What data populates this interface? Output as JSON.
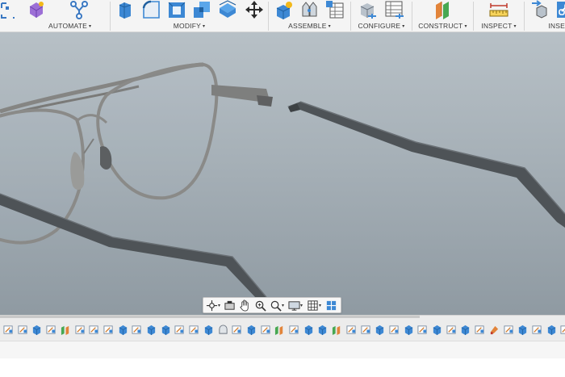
{
  "toolbar": {
    "groups": [
      {
        "id": "automate",
        "label": "AUTOMATE",
        "caret": "▾"
      },
      {
        "id": "modify",
        "label": "MODIFY",
        "caret": "▾"
      },
      {
        "id": "assemble",
        "label": "ASSEMBLE",
        "caret": "▾"
      },
      {
        "id": "configure",
        "label": "CONFIGURE",
        "caret": "▾"
      },
      {
        "id": "construct",
        "label": "CONSTRUCT",
        "caret": "▾"
      },
      {
        "id": "inspect",
        "label": "INSPECT",
        "caret": "▾"
      },
      {
        "id": "insert",
        "label": "INSE",
        "caret": ""
      }
    ],
    "icons": {
      "automate": [
        "select-bracket-icon",
        "create-form-icon",
        "automate-graph-icon"
      ],
      "modify": [
        "press-pull-icon",
        "fillet-icon",
        "shell-icon",
        "combine-icon",
        "offset-face-icon",
        "move-icon"
      ],
      "assemble": [
        "new-component-icon",
        "joint-icon",
        "component-table-icon"
      ],
      "configure": [
        "configure-icon",
        "configuration-table-icon"
      ],
      "construct": [
        "offset-plane-icon"
      ],
      "inspect": [
        "measure-icon"
      ],
      "insert": [
        "insert-derive-icon",
        "insert-link-icon"
      ]
    }
  },
  "viewport": {
    "model": "aviator-glasses-frame",
    "background_top": "#b7c0c6",
    "background_bottom": "#8f9aa2",
    "frame_color": "#8a8a88",
    "temple_color": "#4e5357"
  },
  "navbar": {
    "tools": [
      "orbit-icon",
      "look-at-icon",
      "pan-icon",
      "zoom-window-icon",
      "fit-icon",
      "display-settings-icon",
      "grid-settings-icon",
      "viewports-icon"
    ],
    "carets": [
      "▾",
      "▾",
      "▾",
      "▾"
    ]
  },
  "timeline": {
    "features": [
      "sketch",
      "sketch",
      "extrude",
      "sketch",
      "split",
      "sketch",
      "sketch",
      "sketch",
      "extrude",
      "sketch",
      "extrude",
      "extrude",
      "sketch",
      "sketch",
      "extrude",
      "form",
      "sketch",
      "extrude",
      "sketch",
      "split",
      "sketch",
      "extrude",
      "extrude",
      "split",
      "sketch",
      "sketch",
      "extrude",
      "sketch",
      "extrude",
      "sketch",
      "extrude",
      "sketch",
      "extrude",
      "sketch",
      "appearance",
      "sketch",
      "extrude",
      "sketch",
      "extrude",
      "sketch"
    ]
  }
}
